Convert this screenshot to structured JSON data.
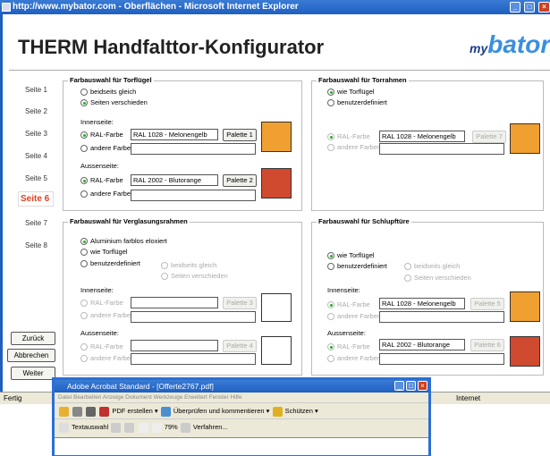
{
  "ie": {
    "title": "http://www.mybator.com - Oberflächen - Microsoft Internet Explorer"
  },
  "app": {
    "title": "THERM Handfalttor-Konfigurator",
    "logo_my": "my",
    "logo_b": "bator"
  },
  "nav": [
    {
      "label": "Seite 1"
    },
    {
      "label": "Seite 2"
    },
    {
      "label": "Seite 3"
    },
    {
      "label": "Seite 4"
    },
    {
      "label": "Seite 5"
    },
    {
      "label": "Seite 6"
    },
    {
      "label": "Seite 7"
    },
    {
      "label": "Seite 8"
    }
  ],
  "buttons": {
    "back": "Zurück",
    "cancel": "Abbrechen",
    "next": "Weiter"
  },
  "g1": {
    "title": "Farbauswahl für Torflügel",
    "opt_same": "beidseits gleich",
    "opt_diff": "Seiten verschieden",
    "inner": "Innenseite:",
    "outer": "Aussenseite:",
    "ral": "RAL-Farbe",
    "other": "andere Farben",
    "inner_val": "RAL 1028 - Melonengelb",
    "outer_val": "RAL 2002 - Blutorange",
    "pal1": "Palette 1",
    "pal2": "Palette 2"
  },
  "g2": {
    "title": "Farbauswahl für Torrahmen",
    "opt_wie": "wie Torflügel",
    "opt_user": "benutzerdefiniert",
    "ral": "RAL-Farbe",
    "other": "andere Farben",
    "val": "RAL 1028 - Melonengelb",
    "pal7": "Palette 7"
  },
  "g3": {
    "title": "Farbauswahl für Verglasungsrahmen",
    "opt_alu": "Aluminium farblos eloxiert",
    "opt_wie": "wie Torflügel",
    "opt_user": "benutzerdefiniert",
    "opt_same": "beidseits gleich",
    "opt_diff": "Seiten verschieden",
    "inner": "Innenseite:",
    "outer": "Aussenseite:",
    "ral": "RAL-Farbe",
    "other": "andere Farben",
    "pal3": "Palette 3",
    "pal4": "Palette 4"
  },
  "g4": {
    "title": "Farbauswahl für Schlupftüre",
    "opt_wie": "wie Torflügel",
    "opt_user": "benutzerdefiniert",
    "opt_same": "beidseits gleich",
    "opt_diff": "Seiten verschieden",
    "inner": "Innenseite:",
    "outer": "Aussenseite:",
    "ral": "RAL-Farbe",
    "other": "andere Farben",
    "inner_val": "RAL 1028 - Melonengelb",
    "outer_val": "RAL 2002 - Blutorange",
    "pal5": "Palette 5",
    "pal6": "Palette 6"
  },
  "colors": {
    "melon": "#f0a030",
    "blood": "#d04a30"
  },
  "status": {
    "left": "Fertig",
    "right": "Internet"
  },
  "acrobat": {
    "title": "Adobe Acrobat Standard - [Offerte2767.pdf]",
    "menu": "Datei  Bearbeiten  Anzeige  Dokument  Werkzeuge  Erweitert  Fenster  Hilfe",
    "pdf_create": "PDF erstellen",
    "review": "Überprüfen und kommentieren",
    "protect": "Schützen",
    "select": "Textauswahl",
    "zoom": "79%",
    "procedures": "Verfahren..."
  }
}
